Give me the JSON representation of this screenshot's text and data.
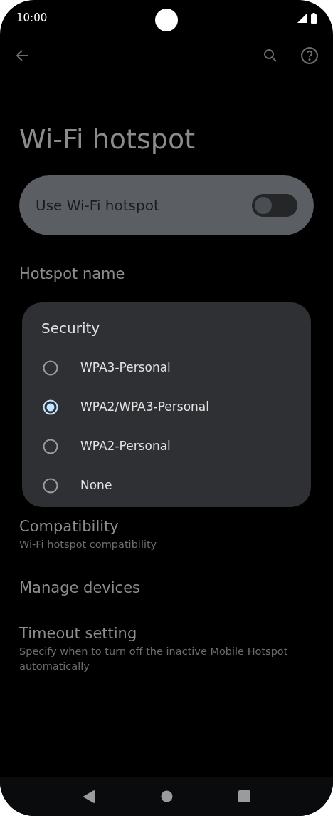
{
  "status_bar": {
    "time": "10:00"
  },
  "title": "Wi-Fi hotspot",
  "main_switch": {
    "label": "Use Wi-Fi hotspot",
    "on": false
  },
  "settings": [
    {
      "title": "Hotspot name"
    },
    {
      "title": "Compatibility",
      "subtitle": "Wi-Fi hotspot compatibility"
    },
    {
      "title": "Manage devices"
    },
    {
      "title": "Timeout setting",
      "subtitle": "Specify when to turn off the inactive Mobile Hotspot automatically"
    }
  ],
  "dialog": {
    "title": "Security",
    "options": [
      {
        "label": "WPA3-Personal",
        "selected": false
      },
      {
        "label": "WPA2/WPA3-Personal",
        "selected": true
      },
      {
        "label": "WPA2-Personal",
        "selected": false
      },
      {
        "label": "None",
        "selected": false
      }
    ]
  }
}
